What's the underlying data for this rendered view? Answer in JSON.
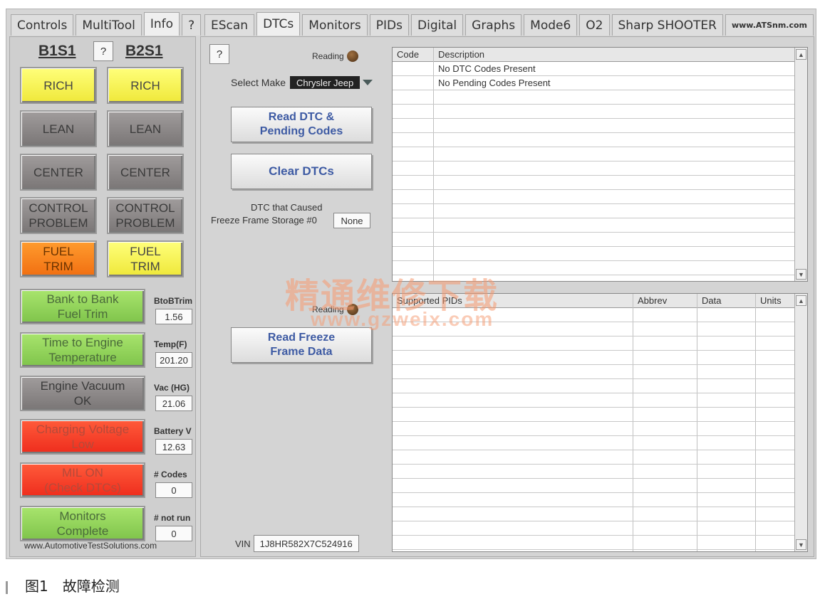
{
  "tabs_left": [
    "Controls",
    "MultiTool",
    "Info",
    "?"
  ],
  "tabs_right": [
    "EScan",
    "DTCs",
    "Monitors",
    "PIDs",
    "Digital",
    "Graphs",
    "Mode6",
    "O2",
    "Sharp SHOOTER",
    "www.ATSnm.com"
  ],
  "active_tab": "DTCs",
  "left": {
    "b1s1": "B1S1",
    "b2s1": "B2S1",
    "help": "?",
    "o2_indicators": [
      {
        "b1": "RICH",
        "b2": "RICH"
      },
      {
        "b1": "LEAN",
        "b2": "LEAN"
      },
      {
        "b1": "CENTER",
        "b2": "CENTER"
      },
      {
        "b1": "CONTROL\nPROBLEM",
        "b2": "CONTROL\nPROBLEM"
      },
      {
        "b1": "FUEL\nTRIM",
        "b2": "FUEL\nTRIM"
      }
    ],
    "status": [
      {
        "label": "Bank to Bank\nFuel Trim",
        "param": "BtoBTrim",
        "value": "1.56"
      },
      {
        "label": "Time to Engine\nTemperature",
        "param": "Temp(F)",
        "value": "201.20"
      },
      {
        "label": "Engine Vacuum\nOK",
        "param": "Vac (HG)",
        "value": "21.06"
      },
      {
        "label": "Charging Voltage\nLow",
        "param": "Battery V",
        "value": "12.63"
      },
      {
        "label": "MIL ON\n(Check DTCs)",
        "param": "# Codes",
        "value": "0"
      },
      {
        "label": "Monitors\nComplete",
        "param": "# not run",
        "value": "0"
      }
    ],
    "footer_url": "www.AutomotiveTestSolutions.com",
    "colors": {
      "yellow": "#f5ef4a",
      "gray": "#8c8888",
      "orange": "#f57f1c",
      "green": "#8fd15a",
      "red": "#f23c27"
    }
  },
  "dtc": {
    "help": "?",
    "reading_label": "Reading",
    "select_make_label": "Select Make",
    "select_make_value": "Chrysler Jeep",
    "read_dtc_button": "Read DTC &\nPending Codes",
    "clear_dtc_button": "Clear DTCs",
    "freeze_label_1": "DTC that Caused",
    "freeze_label_2": "Freeze Frame Storage #0",
    "freeze_value": "None",
    "reading_label_2": "Reading",
    "read_freeze_button": "Read Freeze\nFrame Data",
    "vin_label": "VIN",
    "vin_value": "1J8HR582X7C524916",
    "codes_table": {
      "headers": [
        "Code",
        "Description"
      ],
      "rows": [
        [
          "",
          "No DTC Codes Present"
        ],
        [
          "",
          "No Pending Codes Present"
        ]
      ]
    },
    "pids_table": {
      "headers": [
        "Supported PIDs",
        "Abbrev",
        "Data",
        "Units"
      ]
    }
  },
  "watermark": {
    "line1": "精通维修下载",
    "line2": "www.gzweix.com"
  },
  "caption": "图1　故障检测"
}
